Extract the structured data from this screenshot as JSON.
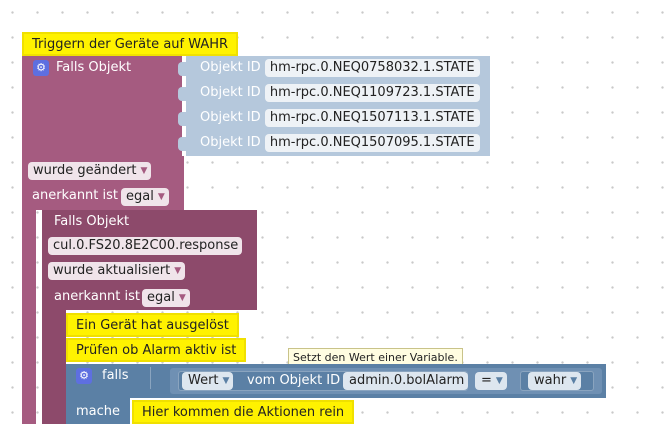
{
  "comments": {
    "trigger_title": "Triggern der Geräte auf WAHR",
    "device_triggered": "Ein Gerät hat ausgelöst",
    "check_alarm": "Prüfen ob Alarm aktiv ist",
    "actions_here": "Hier kommen die Aktionen rein"
  },
  "outer_block": {
    "label": "Falls Objekt",
    "object_id_label": "Objekt ID",
    "object_ids": [
      "hm-rpc.0.NEQ0758032.1.STATE",
      "hm-rpc.0.NEQ1109723.1.STATE",
      "hm-rpc.0.NEQ1507113.1.STATE",
      "hm-rpc.0.NEQ1507095.1.STATE"
    ],
    "change_mode": "wurde geändert",
    "ack_label": "anerkannt ist",
    "ack_value": "egal"
  },
  "inner_block": {
    "label": "Falls Objekt",
    "object_id": "cul.0.FS20.8E2C00.response",
    "change_mode": "wurde aktualisiert",
    "ack_label": "anerkannt ist",
    "ack_value": "egal"
  },
  "if_block": {
    "label": "falls",
    "do_label": "mache",
    "value_dropdown": "Wert",
    "from_object_label": "vom Objekt ID",
    "object_id": "admin.0.bolAlarm",
    "operator": "=",
    "compare_value": "wahr"
  },
  "tooltip": "Setzt den Wert einer Variable."
}
